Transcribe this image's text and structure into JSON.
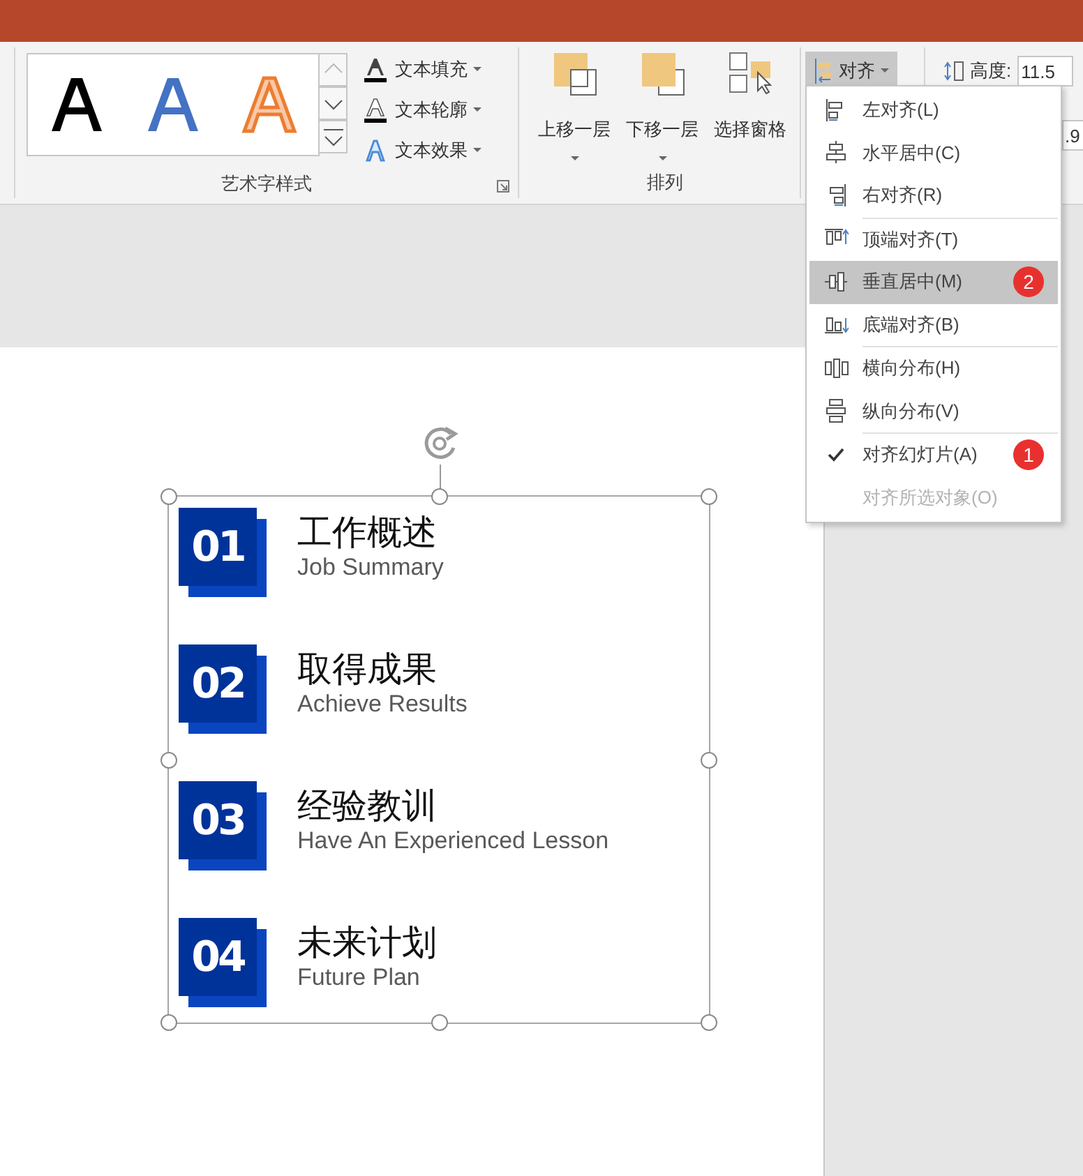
{
  "ribbon": {
    "wordart_gallery": {
      "samples": [
        {
          "kind": "plain"
        },
        {
          "kind": "blue"
        },
        {
          "kind": "outline"
        }
      ]
    },
    "text_buttons": [
      {
        "label": "文本填充"
      },
      {
        "label": "文本轮廓"
      },
      {
        "label": "文本效果"
      }
    ],
    "wordart_group_label": "艺术字样式",
    "arrange_buttons": [
      {
        "label": "上移一层",
        "has_menu": true
      },
      {
        "label": "下移一层",
        "has_menu": true
      },
      {
        "label": "选择窗格",
        "has_menu": false
      }
    ],
    "arrange_group_label": "排列",
    "align_button": {
      "label": "对齐",
      "pressed": true
    },
    "size": {
      "height_label": "高度:",
      "height_value": "11.5",
      "width_value": ".9"
    }
  },
  "align_menu": {
    "groups": [
      [
        {
          "label": "左对齐(L)",
          "checked": false,
          "selected": false,
          "disabled": false
        },
        {
          "label": "水平居中(C)",
          "checked": false,
          "selected": false,
          "disabled": false
        },
        {
          "label": "右对齐(R)",
          "checked": false,
          "selected": false,
          "disabled": false
        }
      ],
      [
        {
          "label": "顶端对齐(T)",
          "checked": false,
          "selected": false,
          "disabled": false
        },
        {
          "label": "垂直居中(M)",
          "checked": false,
          "selected": true,
          "disabled": false,
          "badge": "2"
        },
        {
          "label": "底端对齐(B)",
          "checked": false,
          "selected": false,
          "disabled": false
        }
      ],
      [
        {
          "label": "横向分布(H)",
          "checked": false,
          "selected": false,
          "disabled": false
        },
        {
          "label": "纵向分布(V)",
          "checked": false,
          "selected": false,
          "disabled": false
        }
      ],
      [
        {
          "label": "对齐幻灯片(A)",
          "checked": true,
          "selected": false,
          "disabled": false,
          "badge": "1"
        },
        {
          "label": "对齐所选对象(O)",
          "checked": false,
          "selected": false,
          "disabled": true
        }
      ]
    ]
  },
  "slide": {
    "items": [
      {
        "number": "01",
        "title": "工作概述",
        "subtitle": "Job Summary"
      },
      {
        "number": "02",
        "title": "取得成果",
        "subtitle": "Achieve Results"
      },
      {
        "number": "03",
        "title": "经验教训",
        "subtitle": "Have An Experienced Lesson"
      },
      {
        "number": "04",
        "title": "未来计划",
        "subtitle": "Future Plan"
      }
    ]
  }
}
